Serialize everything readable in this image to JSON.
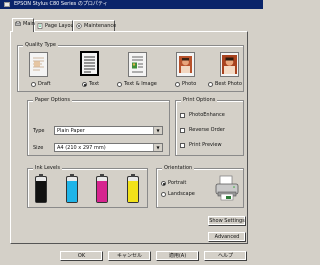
{
  "window": {
    "title": "EPSON Stylus C80 Series のプロパティ"
  },
  "tabs": [
    {
      "label": "Main",
      "icon": "main-icon",
      "active": true
    },
    {
      "label": "Page Layout",
      "icon": "page-layout-icon",
      "active": false
    },
    {
      "label": "Maintenance",
      "icon": "maintenance-icon",
      "active": false
    }
  ],
  "quality_type": {
    "label": "Quality Type",
    "options": [
      {
        "label": "Draft",
        "icon": "draft-page-icon",
        "selected": false
      },
      {
        "label": "Text",
        "icon": "text-page-icon",
        "selected": true
      },
      {
        "label": "Text & Image",
        "icon": "text-image-page-icon",
        "selected": false
      },
      {
        "label": "Photo",
        "icon": "photo-page-icon",
        "selected": false
      },
      {
        "label": "Best Photo",
        "icon": "best-photo-page-icon",
        "selected": false
      }
    ]
  },
  "paper_options": {
    "label": "Paper Options",
    "type_label": "Type",
    "type_value": "Plain Paper",
    "size_label": "Size",
    "size_value": "A4 (210 x 297 mm)"
  },
  "print_options": {
    "label": "Print Options",
    "items": [
      {
        "label": "PhotoEnhance",
        "checked": false
      },
      {
        "label": "Reverse Order",
        "checked": false
      },
      {
        "label": "Print Preview",
        "checked": false
      }
    ]
  },
  "ink_levels": {
    "label": "Ink Levels",
    "inks": [
      {
        "name": "black",
        "color": "#111111",
        "level": 0.85
      },
      {
        "name": "cyan",
        "color": "#1fb4e8",
        "level": 0.85
      },
      {
        "name": "magenta",
        "color": "#d6248f",
        "level": 0.85
      },
      {
        "name": "yellow",
        "color": "#f2e21a",
        "level": 0.85
      }
    ]
  },
  "orientation": {
    "label": "Orientation",
    "options": [
      {
        "label": "Portrait",
        "selected": true
      },
      {
        "label": "Landscape",
        "selected": false
      }
    ]
  },
  "buttons": {
    "show_settings": "Show Settings",
    "advanced": "Advanced",
    "ok": "OK",
    "cancel": "キャンセル",
    "apply": "適用(A)",
    "help": "ヘルプ"
  }
}
